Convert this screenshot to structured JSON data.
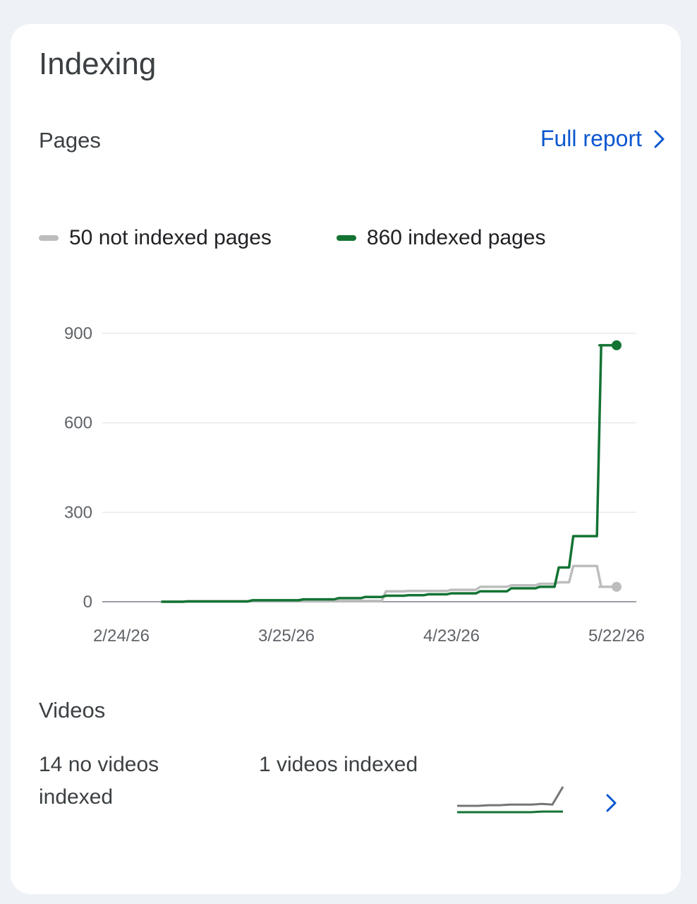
{
  "title": "Indexing",
  "pages": {
    "label": "Pages",
    "full_report": "Full report"
  },
  "legend": [
    {
      "label": "50 not indexed pages",
      "color": "#bdbdbd"
    },
    {
      "label": "860 indexed pages",
      "color": "#137333"
    }
  ],
  "chart_data": {
    "type": "line",
    "ylim": [
      0,
      900
    ],
    "yticks": [
      "900",
      "600",
      "300",
      "0"
    ],
    "ytick_values": [
      900,
      600,
      300,
      0
    ],
    "xticks": [
      "2/24/26",
      "3/25/26",
      "4/23/26",
      "5/22/26"
    ],
    "x_dates": [
      "2026-03-03",
      "2026-03-10",
      "2026-03-25",
      "2026-03-29",
      "2026-04-06",
      "2026-04-08",
      "2026-04-13",
      "2026-04-16",
      "2026-04-20",
      "2026-04-24",
      "2026-04-30",
      "2026-05-05",
      "2026-05-10",
      "2026-05-12",
      "2026-05-15",
      "2026-05-18",
      "2026-05-19",
      "2026-05-22"
    ],
    "series": [
      {
        "name": "50 not indexed pages",
        "color": "#bdbdbd",
        "values": [
          0,
          2,
          3,
          3,
          3,
          3,
          35,
          36,
          36,
          40,
          50,
          55,
          60,
          65,
          120,
          120,
          50,
          50
        ]
      },
      {
        "name": "860 indexed pages",
        "color": "#137333",
        "values": [
          0,
          1,
          5,
          8,
          12,
          16,
          20,
          22,
          25,
          28,
          35,
          45,
          50,
          115,
          220,
          220,
          860,
          860
        ]
      }
    ],
    "grid": true
  },
  "videos": {
    "label": "Videos",
    "not_indexed": "14 no videos indexed",
    "indexed": "1 videos indexed",
    "spark_not_indexed": [
      10,
      10,
      10,
      11,
      11,
      12,
      12,
      12,
      13,
      12,
      40
    ],
    "spark_indexed": [
      0,
      0,
      0,
      0,
      0,
      0,
      0,
      0,
      1,
      1,
      1
    ]
  },
  "colors": {
    "accent": "#0b57d0",
    "indexed": "#137333",
    "not_indexed": "#bdbdbd"
  }
}
